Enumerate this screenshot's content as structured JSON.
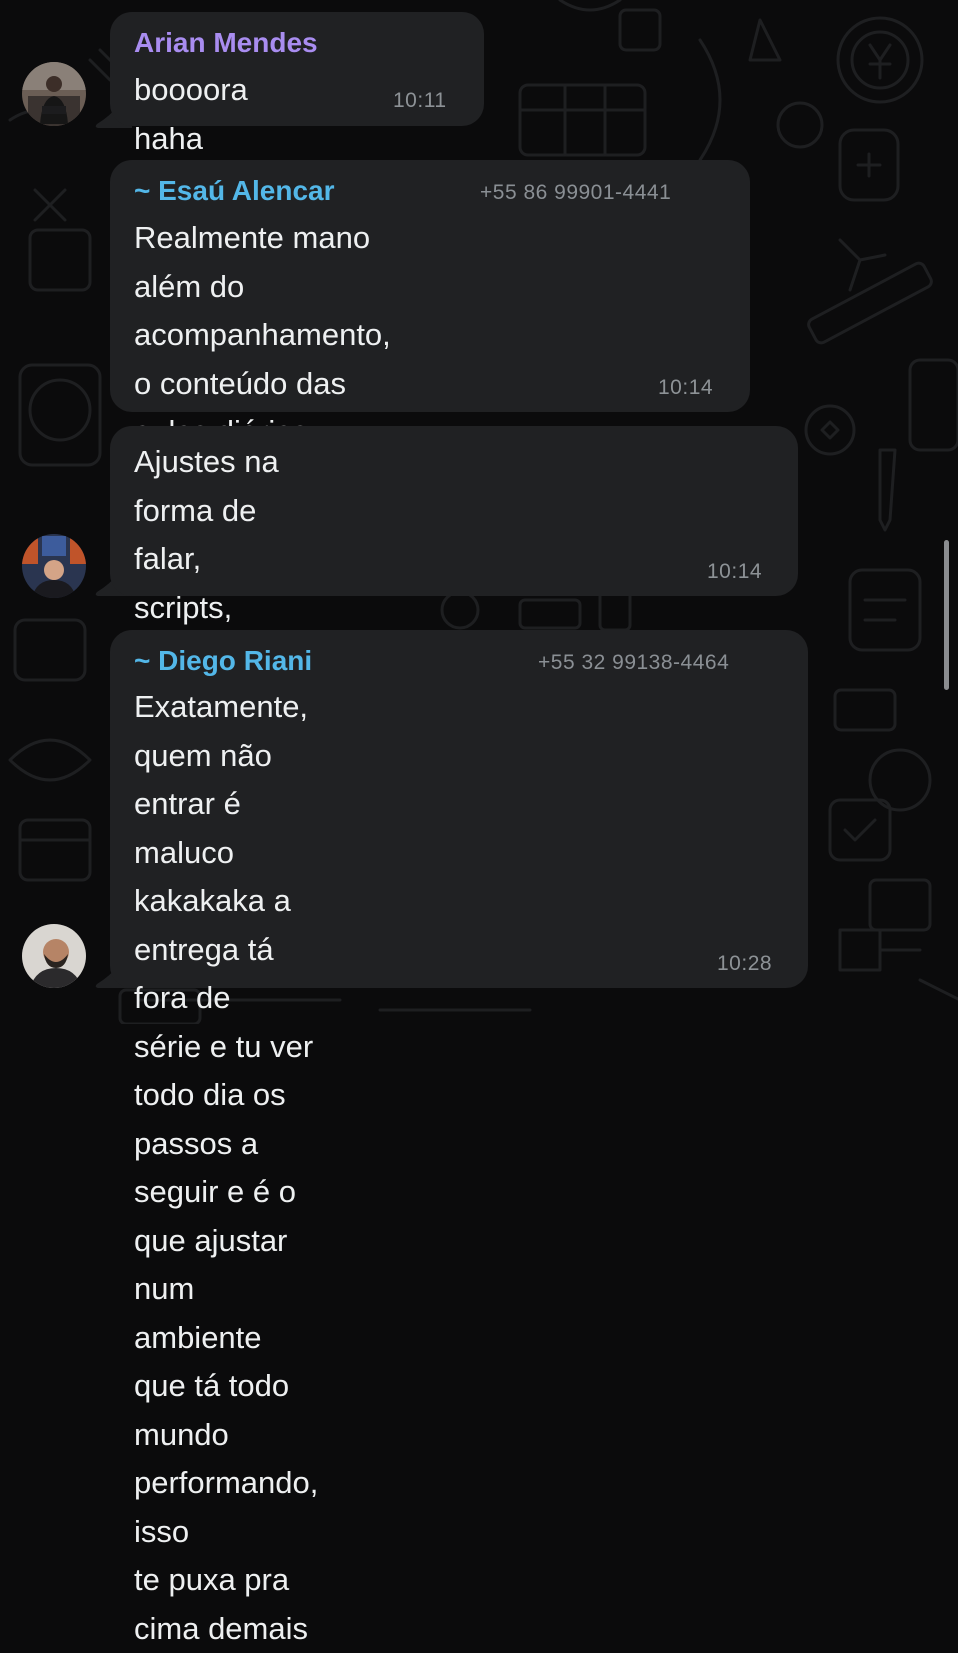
{
  "messages": [
    {
      "sender": "Arian Mendes",
      "phone": "",
      "text": "boooora haha",
      "time": "10:11",
      "sender_color": "#a98df0"
    },
    {
      "sender": "~ Esaú Alencar",
      "phone": "+55 86 99901-4441",
      "text": "Realmente mano além do\nacompanhamento, o conteúdo das\naulas diárias agrega muito mesmo",
      "time": "10:14",
      "sender_color": "#53b7e8"
    },
    {
      "sender": "",
      "phone": "",
      "text": "Ajustes na forma de falar, scripts,\nparada é outro nível, eu já recomendo\npra uma galera",
      "time": "10:14"
    },
    {
      "sender": "~ Diego Riani",
      "phone": "+55 32 99138-4464",
      "text": "Exatamente, quem não entrar é\nmaluco kakakaka a entrega tá fora de\nsérie e tu ver todo dia os passos a\nseguir e é o que ajustar num ambiente\nque tá todo mundo performando, isso\nte puxa pra cima demais",
      "time": "10:28",
      "sender_color": "#53b7e8"
    }
  ],
  "colors": {
    "background": "#0b0b0c",
    "bubble": "#202123",
    "doodle": "#1e1f21"
  }
}
